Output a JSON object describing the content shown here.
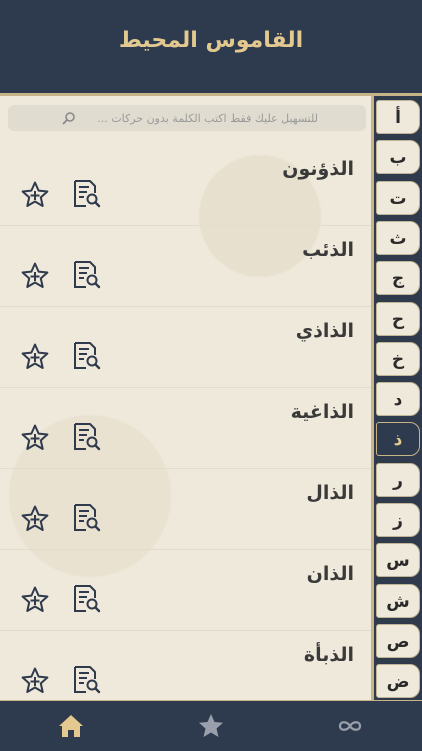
{
  "header": {
    "title": "القاموس المحيط"
  },
  "search": {
    "placeholder": "للتسهيل عليك فقط اكتب الكلمة بدون حركات ...",
    "value": ""
  },
  "words": [
    {
      "label": "الذؤنون"
    },
    {
      "label": "الذئب"
    },
    {
      "label": "الذاذي"
    },
    {
      "label": "الذاغية"
    },
    {
      "label": "الذال"
    },
    {
      "label": "الذان"
    },
    {
      "label": "الذبأة"
    }
  ],
  "alphabet": {
    "letters": [
      "أ",
      "ب",
      "ت",
      "ث",
      "ج",
      "ح",
      "خ",
      "د",
      "ذ",
      "ر",
      "ز",
      "س",
      "ش",
      "ص",
      "ض"
    ],
    "active": "ذ"
  },
  "tabbar": {
    "items": [
      "home-icon",
      "star-icon",
      "infinity-icon"
    ]
  },
  "colors": {
    "header_bg": "#2e3a4e",
    "title_gold": "#e3c98f",
    "content_bg": "#efe9db",
    "accent_border": "#c9b489"
  }
}
